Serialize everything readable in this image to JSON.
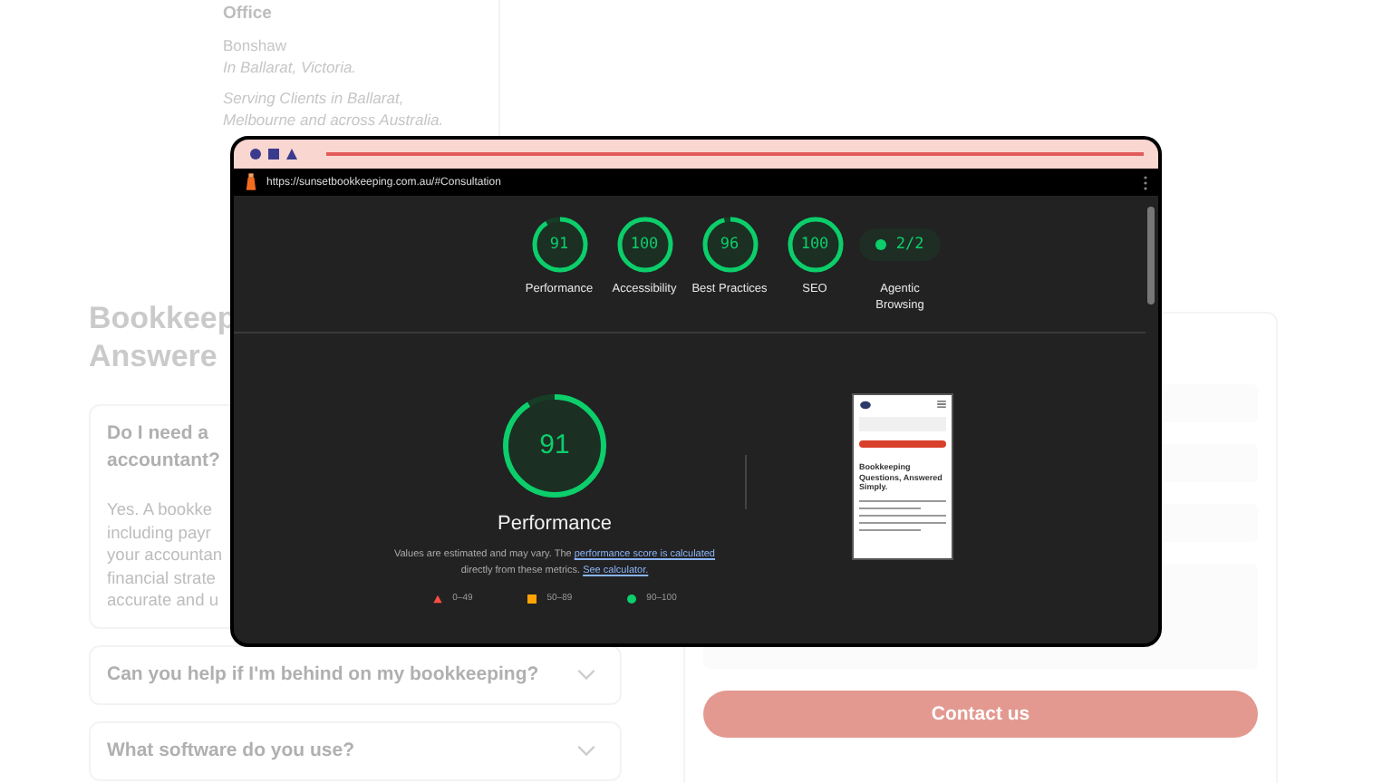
{
  "office": {
    "heading": "Office",
    "place": "Bonshaw",
    "region": "In Ballarat, Victoria.",
    "service_lines": [
      "Serving Clients in Ballarat,",
      "Melbourne and across Australia."
    ]
  },
  "faq": {
    "title_lines": [
      "Bookkeep",
      "Answere"
    ],
    "items": [
      {
        "question_lines": [
          "Do I need a",
          "accountant?"
        ],
        "expanded": true,
        "answer_lines": [
          "Yes. A bookke",
          "including payr",
          "your accountan",
          "financial strate",
          "accurate and u"
        ]
      },
      {
        "question_lines": [
          "Can you help if I'm behind on my bookkeeping?"
        ],
        "expanded": false
      },
      {
        "question_lines": [
          "What software do you use?"
        ],
        "expanded": false
      }
    ]
  },
  "contact": {
    "fields": [
      {
        "kind": "input"
      },
      {
        "kind": "input"
      },
      {
        "kind": "input"
      },
      {
        "kind": "textarea"
      }
    ],
    "button": "Contact us"
  },
  "report": {
    "url": "https://sunsetbookkeeping.com.au/#Consultation",
    "gauges": [
      {
        "score": "91",
        "label": "Performance",
        "level": 0.91
      },
      {
        "score": "100",
        "label": "Accessibility",
        "level": 1
      },
      {
        "score": "96",
        "label": "Best Practices",
        "level": 0.96
      },
      {
        "score": "100",
        "label": "SEO",
        "level": 1
      }
    ],
    "badge": {
      "value": "2/2",
      "label": "Agentic Browsing"
    },
    "main": {
      "score": "91",
      "level": 0.91,
      "title": "Performance"
    },
    "note": {
      "before": "Values are estimated and may vary. The ",
      "link1": "performance score is calculated",
      "middle": " directly from these metrics. ",
      "link2": "See calculator."
    },
    "legend": [
      {
        "kind": "triangle",
        "range": "0–49",
        "color": "#ff4e42"
      },
      {
        "kind": "square",
        "range": "50–89",
        "color": "#ffa400"
      },
      {
        "kind": "circle",
        "range": "90–100",
        "color": "#0cce6b"
      }
    ],
    "thumbnail": {
      "heading": "Bookkeeping Questions, Answered Simply."
    }
  }
}
